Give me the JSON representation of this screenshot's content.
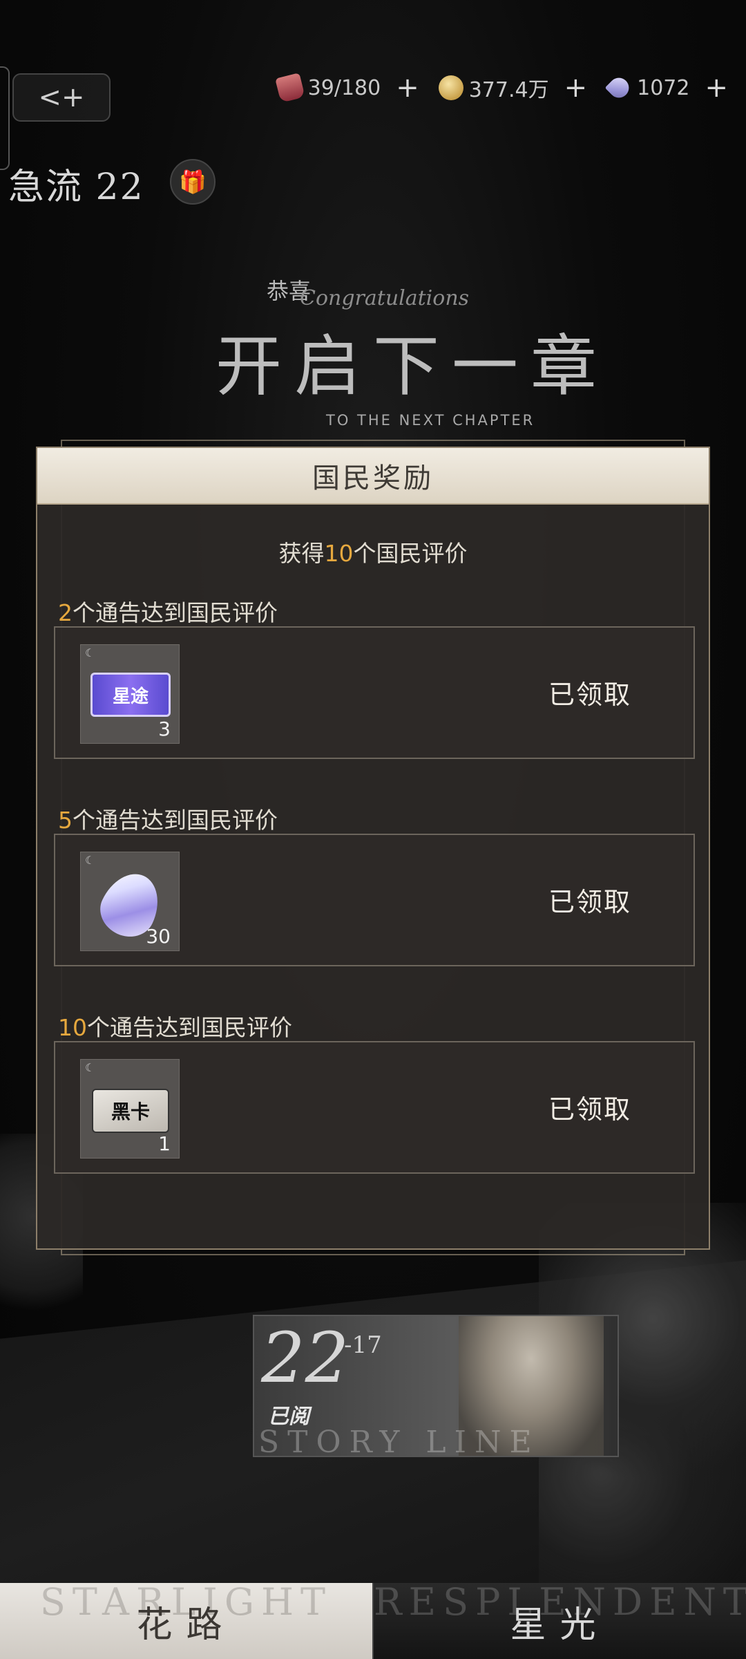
{
  "topbar": {
    "back_icon": "<+",
    "resources": [
      {
        "icon": "energy-drink-icon",
        "value": "39/180"
      },
      {
        "icon": "gold-coin-icon",
        "value": "377.4万"
      },
      {
        "icon": "gem-icon",
        "value": "1072"
      }
    ],
    "plus": "+"
  },
  "chapter": {
    "title": "急流 22",
    "gift_icon": "🎁"
  },
  "banner": {
    "congrats": "恭喜",
    "congrats_script": "Congratulations",
    "title": "开启下一章",
    "subtitle": "TO THE NEXT CHAPTER"
  },
  "modal": {
    "title": "国民奖励",
    "subtitle_prefix": "获得",
    "subtitle_count": "10",
    "subtitle_suffix": "个国民评价",
    "tiers": [
      {
        "count": "2",
        "label": "个通告达到国民评价",
        "item_icon": "star-road-ticket-icon",
        "item_text": "星途",
        "item_count": "3",
        "status": "已领取"
      },
      {
        "count": "5",
        "label": "个通告达到国民评价",
        "item_icon": "diamond-gem-icon",
        "item_count": "30",
        "status": "已领取"
      },
      {
        "count": "10",
        "label": "个通告达到国民评价",
        "item_icon": "black-card-icon",
        "item_text": "黑卡",
        "item_count": "1",
        "status": "已领取"
      }
    ]
  },
  "story_card": {
    "number": "22",
    "sub": "-17",
    "status": "已阅",
    "watermark": "STORY LINE"
  },
  "tabs": [
    {
      "label": "花路",
      "ghost": "STARLIGHT"
    },
    {
      "label": "星光",
      "ghost": "RESPLENDENT"
    }
  ],
  "colors": {
    "accent": "#e6a83e",
    "modal_bg": "#2c2826",
    "header_bg": "#eee8dc"
  }
}
